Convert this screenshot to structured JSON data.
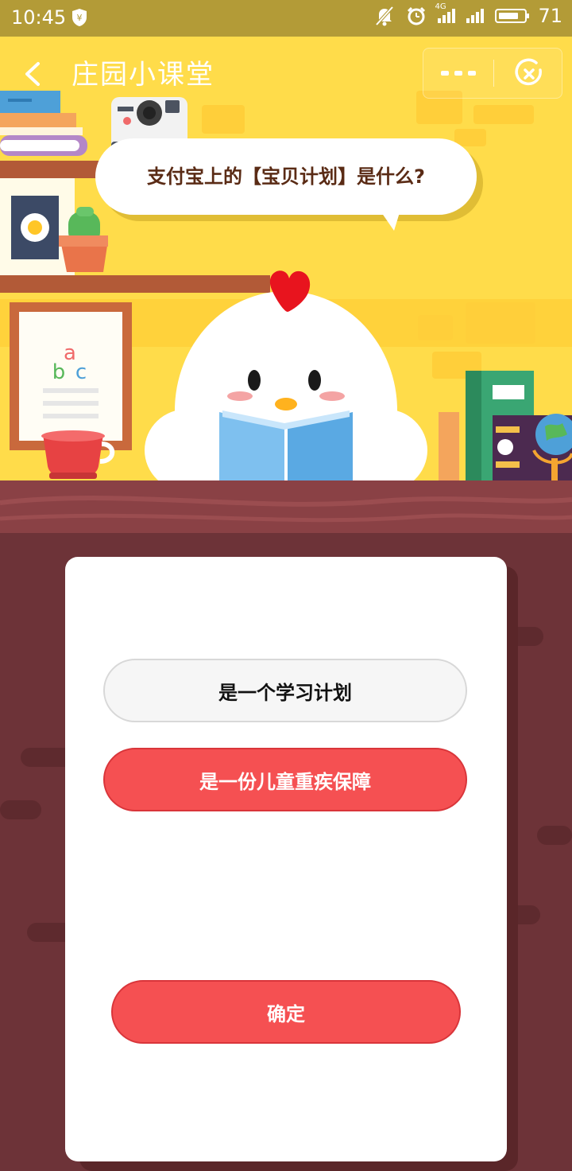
{
  "status_bar": {
    "time": "10:45",
    "network": "4G",
    "battery": "71"
  },
  "navbar": {
    "title": "庄园小课堂"
  },
  "question": {
    "text": "支付宝上的【宝贝计划】是什么?"
  },
  "options": [
    {
      "label": "是一个学习计划",
      "selected": false
    },
    {
      "label": "是一份儿童重疾保障",
      "selected": true
    }
  ],
  "confirm_label": "确定",
  "scene": {
    "poster_letters": [
      "a",
      "b",
      "c"
    ]
  },
  "colors": {
    "scene_background": "#ffdc4a",
    "floor": "#6d3338",
    "accent_red": "#f55052",
    "status_bar": "#b39b37"
  }
}
